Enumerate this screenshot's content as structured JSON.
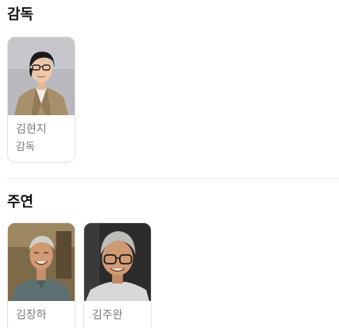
{
  "director_section": {
    "title": "감독",
    "people": [
      {
        "name": "김현지",
        "role": "감독"
      }
    ]
  },
  "cast_section": {
    "title": "주연",
    "people": [
      {
        "name": "김장하"
      },
      {
        "name": "김주완"
      }
    ]
  }
}
